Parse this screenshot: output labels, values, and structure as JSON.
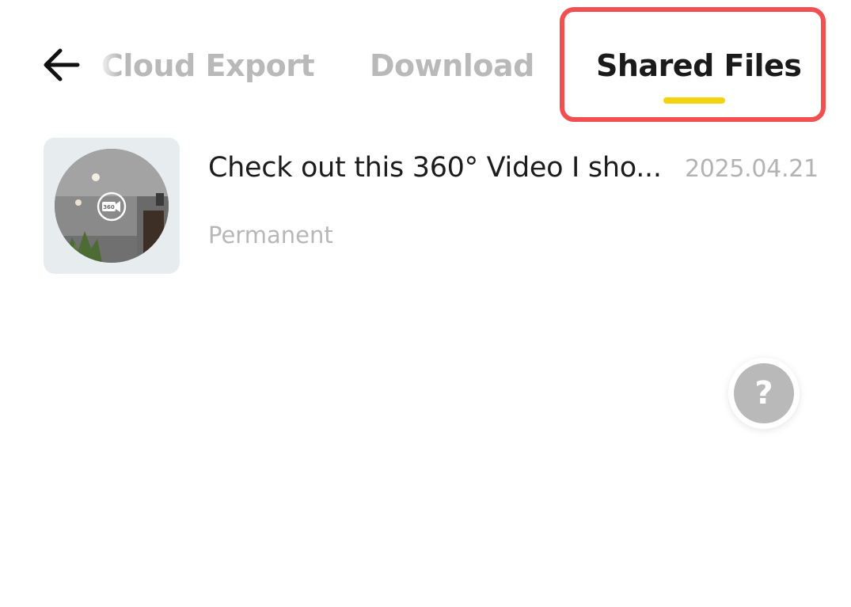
{
  "header": {
    "back_icon": "arrow-left-icon",
    "tabs": [
      {
        "label": "Cloud Export",
        "active": false
      },
      {
        "label": "Download",
        "active": false
      },
      {
        "label": "Shared Files",
        "active": true
      }
    ],
    "accent_color": "#f5d20f",
    "highlight_color": "#f24f50"
  },
  "files": [
    {
      "title": "Check out this 360° Video I sho...",
      "date": "2025.04.21",
      "status": "Permanent",
      "thumbnail_badge": "360"
    }
  ],
  "help": {
    "label": "?",
    "icon": "help-icon"
  }
}
